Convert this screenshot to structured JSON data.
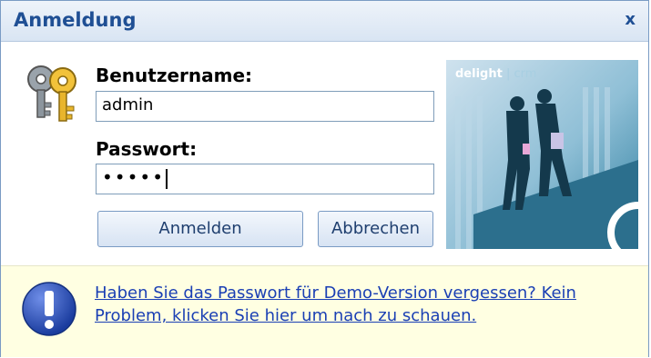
{
  "dialog": {
    "title": "Anmeldung",
    "close_label": "x"
  },
  "form": {
    "username_label": "Benutzername:",
    "username_value": "admin",
    "password_label": "Passwort:",
    "password_mask": "•••••"
  },
  "buttons": {
    "login_label": "Anmelden",
    "cancel_label": "Abbrechen"
  },
  "promo": {
    "brand": "delight",
    "separator": " | ",
    "product": "crm"
  },
  "info": {
    "message": "Haben Sie das Passwort für Demo-Version vergessen? Kein Problem, klicken Sie hier um nach zu schauen."
  },
  "icons": {
    "keys": "keys-icon",
    "info": "exclamation-icon",
    "close": "close-icon"
  },
  "colors": {
    "title": "#1f4f94",
    "link": "#1a3fb4",
    "banner": "#ffffe2"
  }
}
